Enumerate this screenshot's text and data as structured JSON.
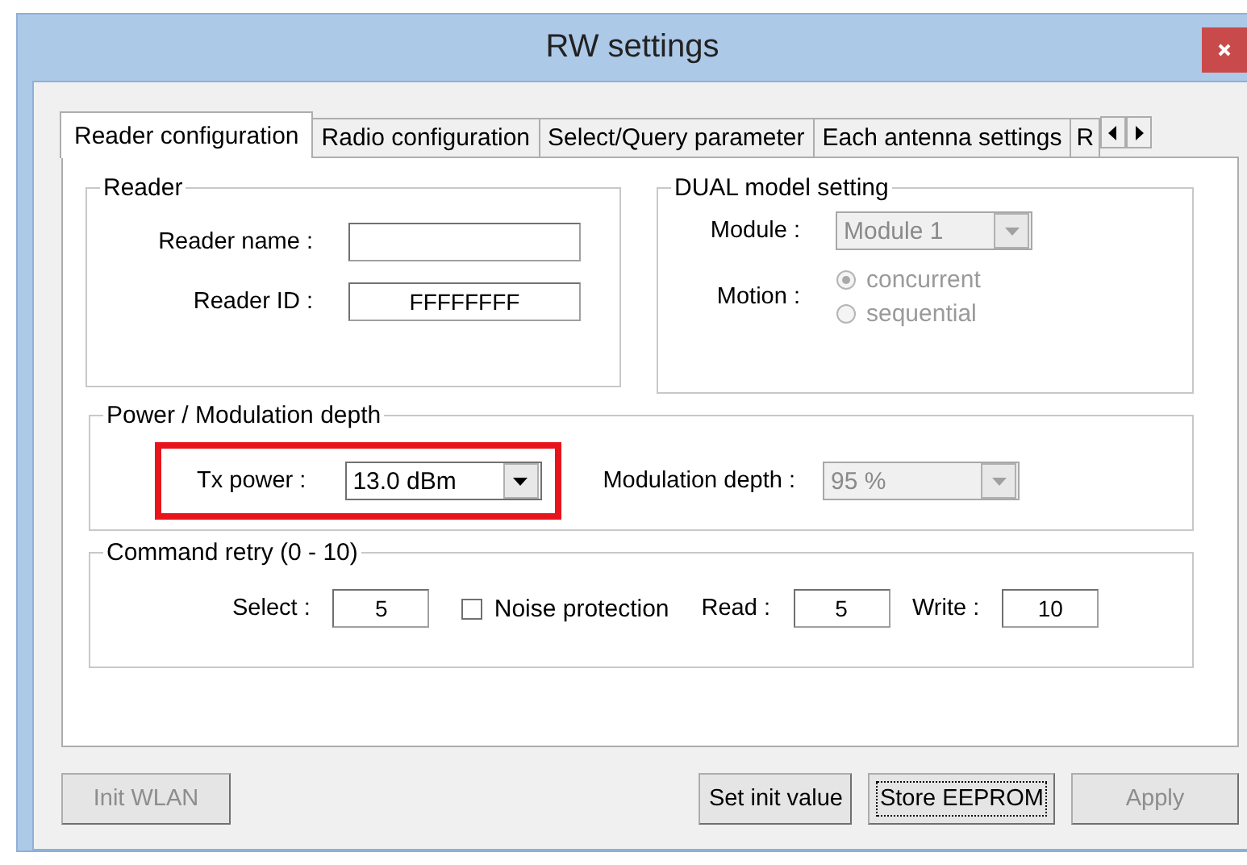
{
  "window": {
    "title": "RW settings"
  },
  "tabs": [
    {
      "label": "Reader configuration",
      "selected": true
    },
    {
      "label": "Radio configuration",
      "selected": false
    },
    {
      "label": "Select/Query parameter",
      "selected": false
    },
    {
      "label": "Each antenna settings",
      "selected": false
    },
    {
      "label": "R",
      "selected": false
    }
  ],
  "reader": {
    "title": "Reader",
    "fields": [
      {
        "label": "Reader name :"
      },
      {
        "label": "Reader ID :",
        "value": "FFFFFFFF"
      }
    ]
  },
  "dual": {
    "title": "DUAL model setting",
    "module": {
      "label": "Module :",
      "value": "Module 1",
      "disabled": true
    },
    "motion": {
      "label": "Motion :",
      "disabled": true,
      "options": [
        {
          "label": "concurrent",
          "selected": true
        },
        {
          "label": "sequential",
          "selected": false
        }
      ]
    }
  },
  "power": {
    "title": "Power / Modulation depth",
    "tx_power": {
      "label": "Tx power :",
      "value": "13.0 dBm",
      "disabled": false,
      "highlighted": true
    },
    "modulation": {
      "label": "Modulation depth :",
      "value": "95 %",
      "disabled": true
    }
  },
  "retry": {
    "title": "Command retry (0 - 10)",
    "select": {
      "label": "Select :",
      "value": "5"
    },
    "noise": {
      "label": "Noise protection",
      "checked": false
    },
    "read": {
      "label": "Read :",
      "value": "5"
    },
    "write": {
      "label": "Write :",
      "value": "10"
    }
  },
  "buttons": [
    {
      "label": "Init WLAN",
      "disabled": true,
      "focused": false
    },
    {
      "label": "Set init value",
      "disabled": false,
      "focused": false
    },
    {
      "label": "Store EEPROM",
      "disabled": false,
      "focused": true
    },
    {
      "label": "Apply",
      "disabled": true,
      "focused": false
    }
  ]
}
